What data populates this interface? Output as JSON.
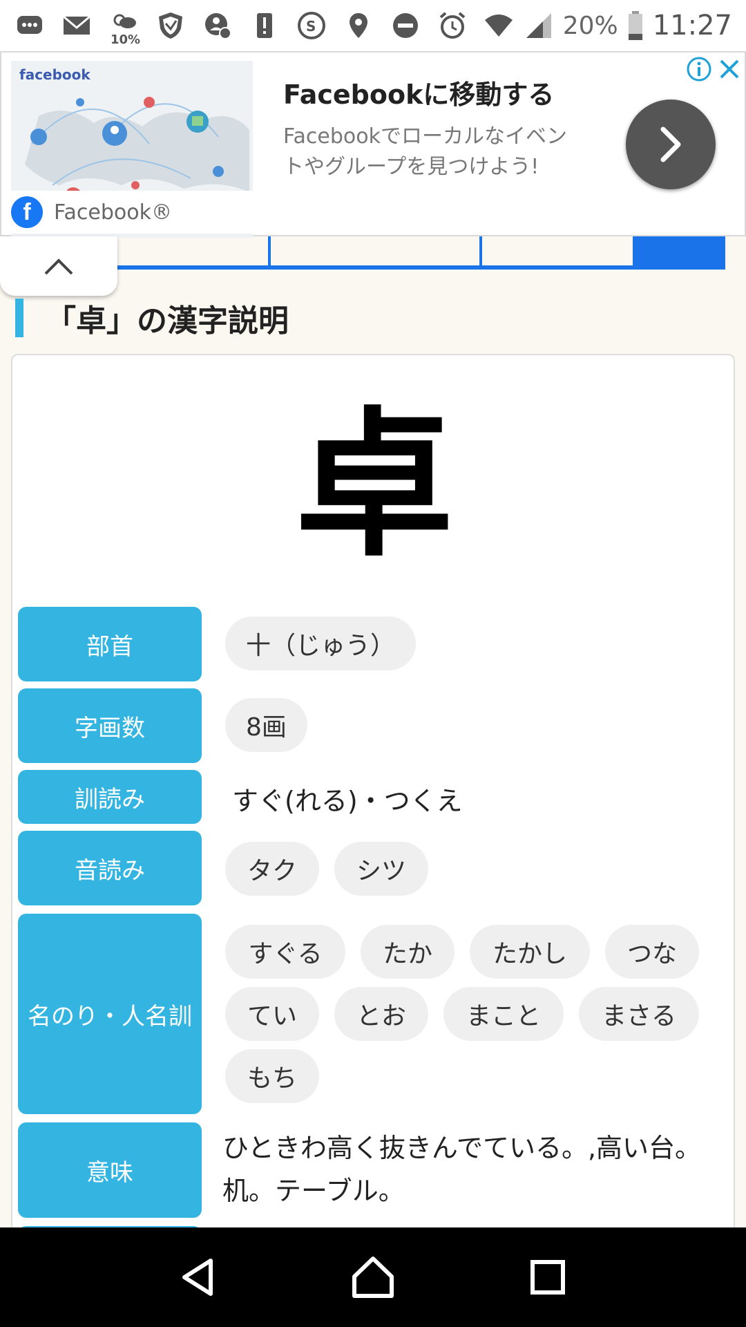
{
  "status_bar": {
    "weather_percent": "10%",
    "battery_percent": "20%",
    "time": "11:27",
    "icons": [
      "chat-icon",
      "mail-icon",
      "weather-icon",
      "shield-icon",
      "account-sync-icon",
      "alert-icon",
      "calendar-icon",
      "location-icon",
      "do-not-disturb-icon",
      "alarm-icon",
      "wifi-icon",
      "signal-icon",
      "battery-icon"
    ]
  },
  "ad": {
    "image_brand": "facebook",
    "title": "Facebookに移動する",
    "description": "Facebookでローカルなイベントやグループを見つけよう!",
    "advertiser": "Facebook®"
  },
  "section": {
    "heading": "「卓」の漢字説明"
  },
  "kanji": {
    "character": "卓",
    "rows": {
      "radical": {
        "label": "部首",
        "value": "十（じゅう）"
      },
      "strokes": {
        "label": "字画数",
        "value": "8画"
      },
      "kun": {
        "label": "訓読み",
        "value": "すぐ(れる)・つくえ"
      },
      "on": {
        "label": "音読み",
        "values": [
          "タク",
          "シツ"
        ]
      },
      "nanori": {
        "label": "名のり・人名訓",
        "values": [
          "すぐる",
          "たか",
          "たかし",
          "つな",
          "てい",
          "とお",
          "まこと",
          "まさる",
          "もち"
        ]
      },
      "meaning": {
        "label": "意味",
        "value": "ひときわ高く抜きんでている。,高い台。机。テーブル。"
      }
    }
  },
  "colors": {
    "label_bg": "#34b4e0",
    "accent_blue": "#1a73e8",
    "pill_bg": "#efefef"
  }
}
